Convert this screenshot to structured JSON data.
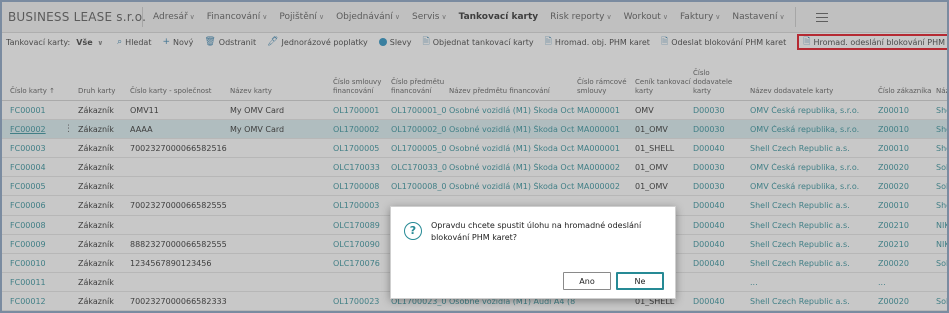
{
  "app": {
    "brand": "BUSINESS LEASE s.r.o."
  },
  "nav": [
    {
      "label": "Adresář",
      "dropdown": true,
      "active": false
    },
    {
      "label": "Financování",
      "dropdown": true,
      "active": false
    },
    {
      "label": "Pojištění",
      "dropdown": true,
      "active": false
    },
    {
      "label": "Objednávání",
      "dropdown": true,
      "active": false
    },
    {
      "label": "Servis",
      "dropdown": true,
      "active": false
    },
    {
      "label": "Tankovací karty",
      "dropdown": false,
      "active": true
    },
    {
      "label": "Risk reporty",
      "dropdown": true,
      "active": false
    },
    {
      "label": "Workout",
      "dropdown": true,
      "active": false
    },
    {
      "label": "Faktury",
      "dropdown": true,
      "active": false
    },
    {
      "label": "Nastavení",
      "dropdown": true,
      "active": false
    }
  ],
  "actionbar": {
    "title": "Tankovací karty:",
    "filter": "Vše",
    "items": [
      {
        "name": "search",
        "icon": "search-icon",
        "glyph": "⌕",
        "label": "Hledat"
      },
      {
        "name": "new",
        "icon": "plus-icon",
        "glyph": "+",
        "label": "Nový"
      },
      {
        "name": "delete",
        "icon": "trash-icon",
        "glyph": "🗑",
        "label": "Odstranit"
      },
      {
        "name": "one-time-fees",
        "icon": "document-icon",
        "glyph": "🖊",
        "label": "Jednorázové poplatky"
      },
      {
        "name": "discounts",
        "icon": "circle-icon",
        "glyph": "",
        "label": "Slevy"
      },
      {
        "name": "order-card",
        "icon": "order-icon",
        "glyph": "🗎",
        "label": "Objednat tankovací karty"
      },
      {
        "name": "bulk-order-phm",
        "icon": "document-icon",
        "glyph": "🗎",
        "label": "Hromad. obj. PHM karet"
      },
      {
        "name": "send-block",
        "icon": "document-icon",
        "glyph": "🗎",
        "label": "Odeslat blokování PHM karet"
      },
      {
        "name": "bulk-send-block",
        "icon": "document-icon",
        "glyph": "🗎",
        "label": "Hromad. odeslání blokování PHM karet"
      }
    ]
  },
  "table": {
    "columns": [
      "Číslo karty ↑",
      "Druh karty",
      "Číslo karty - společnost",
      "Název karty",
      "Číslo smlouvy financování",
      "Číslo předmětu financování",
      "Název předmětu financování",
      "Číslo rámcové smlouvy",
      "Ceník tankovací karty",
      "Číslo dodavatele karty",
      "Název dodavatele karty",
      "Číslo zákazníka",
      "Náz"
    ],
    "rows": [
      [
        "FC00001",
        "Zákazník",
        "OMV11",
        "My OMV Card",
        "OL1700001",
        "OL1700001_01",
        "Osobné vozidlá (M1) Škoda Octa...",
        "MA000001",
        "OMV",
        "D00030",
        "OMV Česká republika, s.r.o.",
        "Z00010",
        "She"
      ],
      [
        "FC00002",
        "Zákazník",
        "AAAA",
        "My OMV Card",
        "OL1700002",
        "OL1700002_01",
        "Osobné vozidlá (M1) Škoda Octa...",
        "MA000001",
        "01_OMV",
        "D00030",
        "OMV Česká republika, s.r.o.",
        "Z00010",
        "She"
      ],
      [
        "FC00003",
        "Zákazník",
        "7002327000066582516",
        "",
        "OL1700005",
        "OL1700005_01",
        "Osobné vozidlá (M1) Škoda Octa...",
        "MA000001",
        "01_SHELL",
        "D00040",
        "Shell Czech Republic a.s.",
        "Z00010",
        "She"
      ],
      [
        "FC00004",
        "Zákazník",
        "",
        "",
        "OLC170033",
        "OLC170033_01",
        "Osobné vozidlá (M1) Škoda Octa...",
        "MA000002",
        "01_OMV",
        "D00030",
        "OMV Česká republika, s.r.o.",
        "Z00020",
        "Soli"
      ],
      [
        "FC00005",
        "Zákazník",
        "",
        "",
        "OL1700008",
        "OL1700008_01",
        "Osobné vozidlá (M1) Škoda Octa...",
        "MA000002",
        "01_OMV",
        "D00030",
        "OMV Česká republika, s.r.o.",
        "Z00020",
        "Soli"
      ],
      [
        "FC00006",
        "Zákazník",
        "7002327000066582555",
        "",
        "OL1700003",
        "",
        "",
        "",
        "",
        "D00040",
        "Shell Czech Republic a.s.",
        "Z00010",
        "She"
      ],
      [
        "FC00008",
        "Zákazník",
        "",
        "",
        "OLC170089",
        "",
        "",
        "",
        "",
        "D00040",
        "Shell Czech Republic a.s.",
        "Z00210",
        "NIK"
      ],
      [
        "FC00009",
        "Zákazník",
        "8882327000066582555",
        "",
        "OLC170090",
        "",
        "",
        "",
        "",
        "D00040",
        "Shell Czech Republic a.s.",
        "Z00210",
        "NIK"
      ],
      [
        "FC00010",
        "Zákazník",
        "1234567890123456",
        "",
        "OLC170076",
        "",
        "",
        "",
        "",
        "D00040",
        "Shell Czech Republic a.s.",
        "Z00020",
        "Soli"
      ],
      [
        "FC00011",
        "Zákazník",
        "",
        "",
        "",
        "",
        "",
        "",
        "",
        "",
        "...",
        "...",
        ""
      ],
      [
        "FC00012",
        "Zákazník",
        "7002327000066582333",
        "",
        "OL1700023",
        "OL1700023_01",
        "Osobné vozidlá (M1) Audi A4 (8D)",
        "",
        "01_SHELL",
        "D00040",
        "Shell Czech Republic a.s.",
        "Z00020",
        "Soli"
      ]
    ],
    "selected_row": 1
  },
  "dialog": {
    "icon": "question-icon",
    "glyph": "?",
    "message": "Opravdu chcete spustit úlohu na hromadné odeslání blokování PHM karet?",
    "yes_label": "Ano",
    "no_label": "Ne"
  },
  "colors": {
    "link": "#268a95",
    "highlight_border": "#e0000f",
    "selected_row": "#d9eef0"
  }
}
